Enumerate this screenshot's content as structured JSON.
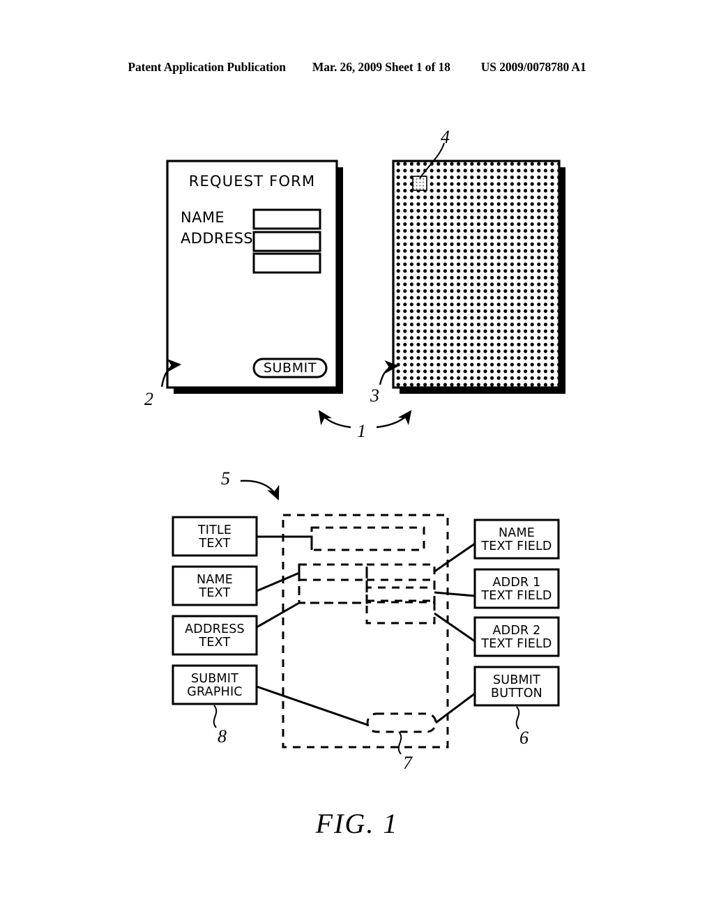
{
  "header": {
    "publication": "Patent Application Publication",
    "date_sheet": "Mar. 26, 2009  Sheet 1 of 18",
    "patent_number": "US 2009/0078780 A1"
  },
  "figure": {
    "caption": "FIG. 1",
    "form_page": {
      "title": "REQUEST FORM",
      "labels": [
        "NAME",
        "ADDRESS"
      ],
      "field_count": 3,
      "submit_label": "SUBMIT",
      "reference_numeral": "2"
    },
    "coded_page": {
      "reference_numeral": "3",
      "tag_reference_numeral": "4",
      "pattern": "infrared-dot-grid"
    },
    "pair_reference_numeral": "1",
    "block_diagram": {
      "reference_numeral": "5",
      "left_boxes": [
        {
          "line1": "TITLE",
          "line2": "TEXT"
        },
        {
          "line1": "NAME",
          "line2": "TEXT"
        },
        {
          "line1": "ADDRESS",
          "line2": "TEXT"
        },
        {
          "line1": "SUBMIT",
          "line2": "GRAPHIC"
        }
      ],
      "left_group_reference_numeral": "8",
      "right_boxes": [
        {
          "line1": "NAME",
          "line2": "TEXT FIELD"
        },
        {
          "line1": "ADDR 1",
          "line2": "TEXT FIELD"
        },
        {
          "line1": "ADDR 2",
          "line2": "TEXT FIELD"
        },
        {
          "line1": "SUBMIT",
          "line2": "BUTTON"
        }
      ],
      "right_group_reference_numeral": "6",
      "submit_zone_reference_numeral": "7"
    }
  },
  "colors": {
    "ink": "#000000",
    "paper": "#ffffff"
  }
}
